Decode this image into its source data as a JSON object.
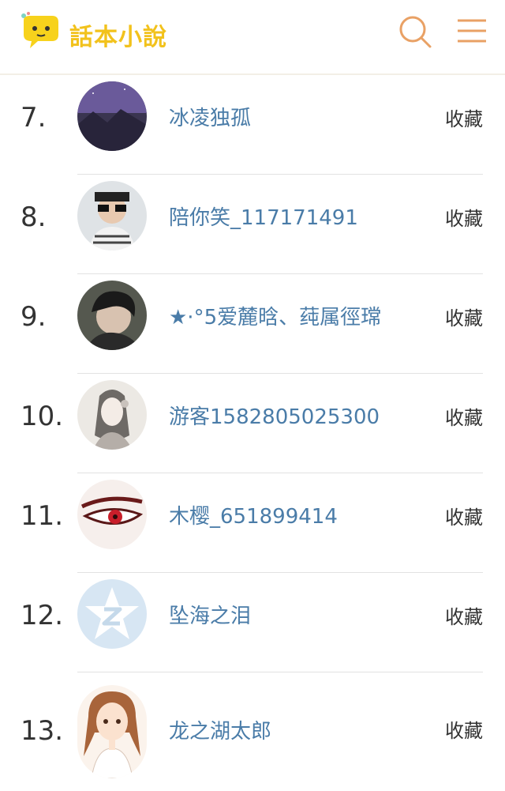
{
  "header": {
    "brand": "話本小說",
    "search_icon": "search-icon",
    "menu_icon": "menu-icon"
  },
  "colors": {
    "brand": "#f2c21c",
    "accent": "#e9a165",
    "name_link": "#4a7ca8"
  },
  "rows": [
    {
      "rank": "7.",
      "name": "冰凌独孤",
      "action": "收藏"
    },
    {
      "rank": "8.",
      "name": "陪你笑_117171491",
      "action": "收藏"
    },
    {
      "rank": "9.",
      "name": "★·°5爱麓晗、莼属徑瑺",
      "action": "收藏"
    },
    {
      "rank": "10.",
      "name": "游客1582805025300",
      "action": "收藏"
    },
    {
      "rank": "11.",
      "name": "木樱_651899414",
      "action": "收藏"
    },
    {
      "rank": "12.",
      "name": "坠海之泪",
      "action": "收藏"
    },
    {
      "rank": "13.",
      "name": "龙之湖太郎",
      "action": "收藏"
    }
  ]
}
